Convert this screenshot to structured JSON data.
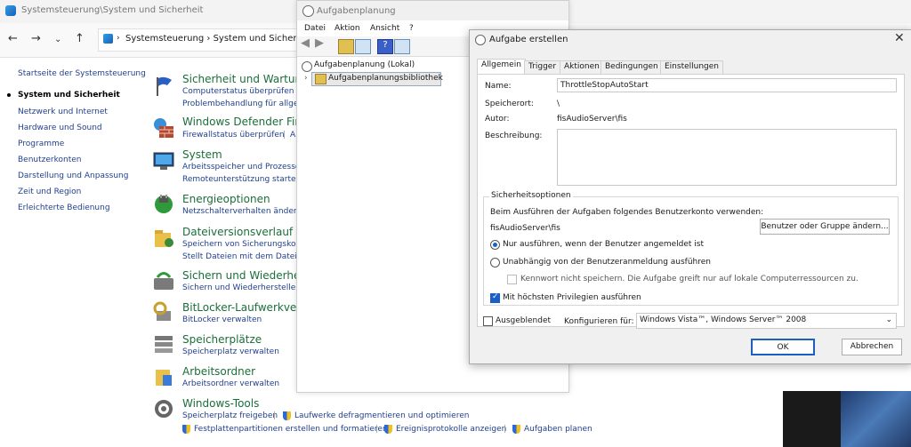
{
  "control_panel": {
    "title": "Systemsteuerung\\System und Sicherheit",
    "breadcrumb": [
      "Systemsteuerung",
      "System und Sicherheit"
    ],
    "sidebar": [
      {
        "label": "Startseite der Systemsteuerung",
        "active": false
      },
      {
        "label": "System und Sicherheit",
        "active": true
      },
      {
        "label": "Netzwerk und Internet",
        "active": false
      },
      {
        "label": "Hardware und Sound",
        "active": false
      },
      {
        "label": "Programme",
        "active": false
      },
      {
        "label": "Benutzerkonten",
        "active": false
      },
      {
        "label": "Darstellung und Anpassung",
        "active": false
      },
      {
        "label": "Zeit und Region",
        "active": false
      },
      {
        "label": "Erleichterte Bedienung",
        "active": false
      }
    ],
    "categories": [
      {
        "title": "Sicherheit und Wartung",
        "links": [
          "Computerstatus überprüfen und",
          "Problembehandlung für allgem"
        ],
        "icon": "flag-icon"
      },
      {
        "title": "Windows Defender Firew",
        "links": [
          "Firewallstatus überprüfen",
          "A"
        ],
        "icon": "firewall-icon"
      },
      {
        "title": "System",
        "links": [
          "Arbeitsspeicher und Prozessorg",
          "Remoteunterstützung starten"
        ],
        "icon": "monitor-icon"
      },
      {
        "title": "Energieoptionen",
        "links": [
          "Netzschalterverhalten ändern"
        ],
        "icon": "power-icon"
      },
      {
        "title": "Dateiversionsverlauf",
        "links": [
          "Speichern von Sicherungskopie",
          "Stellt Dateien mit dem Dateiver"
        ],
        "icon": "file-history-icon"
      },
      {
        "title": "Sichern und Wiederhers",
        "links": [
          "Sichern und Wiederherstellen (W"
        ],
        "icon": "backup-icon"
      },
      {
        "title": "BitLocker-Laufwerkversc",
        "links": [
          "BitLocker verwalten"
        ],
        "icon": "bitlocker-icon"
      },
      {
        "title": "Speicherplätze",
        "links": [
          "Speicherplatz verwalten"
        ],
        "icon": "storage-icon"
      },
      {
        "title": "Arbeitsordner",
        "links": [
          "Arbeitsordner verwalten"
        ],
        "icon": "work-folder-icon"
      },
      {
        "title": "Windows-Tools",
        "links": [
          "Speicherplatz freigeben",
          "Laufwerke defragmentieren und optimieren",
          "Festplattenpartitionen erstellen und formatieren",
          "Ereignisprotokolle anzeigen",
          "Aufgaben planen"
        ],
        "icon": "tools-icon"
      }
    ]
  },
  "task_scheduler": {
    "title": "Aufgabenplanung",
    "menu": [
      "Datei",
      "Aktion",
      "Ansicht",
      "?"
    ],
    "tree": {
      "root": "Aufgabenplanung (Lokal)",
      "child": "Aufgabenplanungsbibliothek"
    }
  },
  "dialog": {
    "title": "Aufgabe erstellen",
    "tabs": [
      "Allgemein",
      "Trigger",
      "Aktionen",
      "Bedingungen",
      "Einstellungen"
    ],
    "name_label": "Name:",
    "name_value": "ThrottleStopAutoStart",
    "location_label": "Speicherort:",
    "location_value": "\\",
    "author_label": "Autor:",
    "author_value": "fisAudioServer\\fis",
    "description_label": "Beschreibung:",
    "description_value": "",
    "security_group": "Sicherheitsoptionen",
    "account_prompt": "Beim Ausführen der Aufgaben folgendes Benutzerkonto verwenden:",
    "account_value": "fisAudioServer\\fis",
    "change_user_button": "Benutzer oder Gruppe ändern...",
    "radio_logged_on": "Nur ausführen, wenn der Benutzer angemeldet ist",
    "radio_independent": "Unabhängig von der Benutzeranmeldung ausführen",
    "no_password_label": "Kennwort nicht speichern. Die Aufgabe greift nur auf lokale Computerressourcen zu.",
    "highest_privileges_label": "Mit höchsten Privilegien ausführen",
    "hidden_label": "Ausgeblendet",
    "configure_label": "Konfigurieren für:",
    "configure_value": "Windows Vista™, Windows Server™ 2008",
    "ok_button": "OK",
    "cancel_button": "Abbrechen",
    "logged_on_selected": true,
    "highest_privileges_checked": true,
    "hidden_checked": false
  }
}
